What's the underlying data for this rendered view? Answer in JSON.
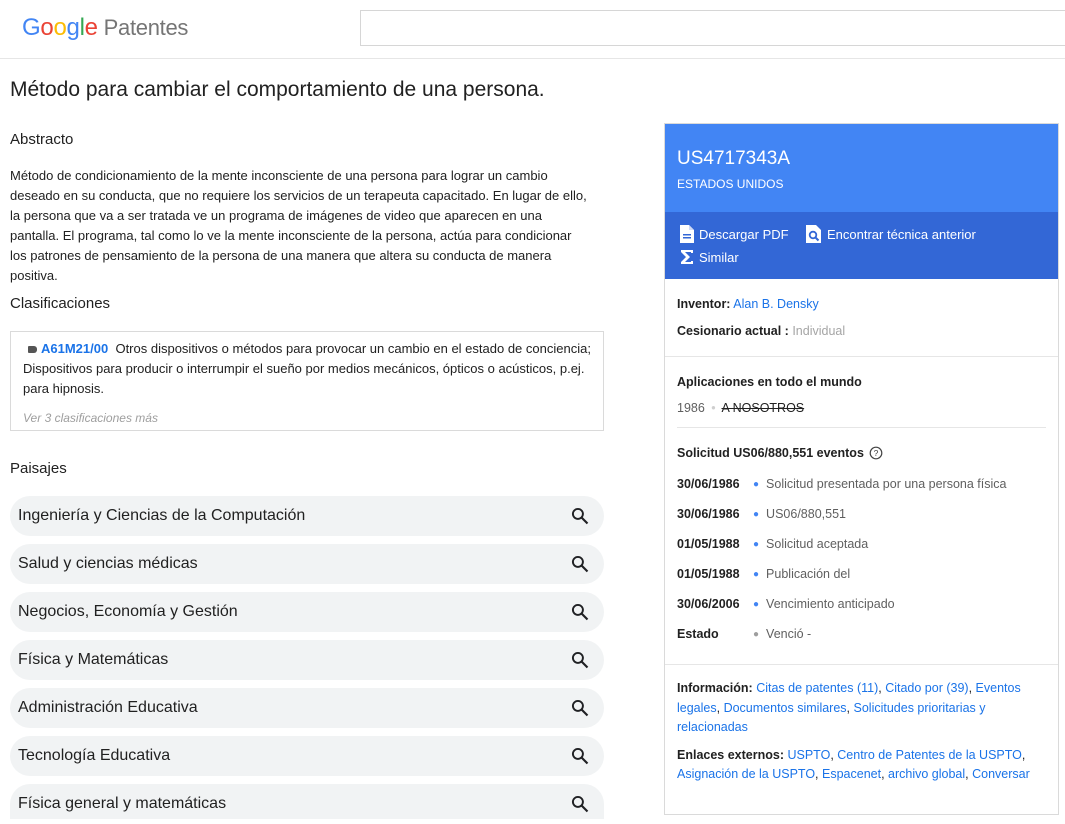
{
  "header": {
    "logo_letters": [
      "G",
      "o",
      "o",
      "g",
      "l",
      "e"
    ],
    "product": "Patentes",
    "search_value": ""
  },
  "title": "Método para cambiar el comportamiento de una persona.",
  "abstract": {
    "heading": "Abstracto",
    "text": "Método de condicionamiento de la mente inconsciente de una persona para lograr un cambio deseado en su conducta, que no requiere los servicios de un terapeuta capacitado. En lugar de ello, la persona que va a ser tratada ve un programa de imágenes de video que aparecen en una pantalla. El programa, tal como lo ve la mente inconsciente de la persona, actúa para condicionar los patrones de pensamiento de la persona de una manera que altera su conducta de manera positiva."
  },
  "classifications": {
    "heading": "Clasificaciones",
    "code": "A61M21/00",
    "description": "Otros dispositivos o métodos para provocar un cambio en el estado de conciencia; Dispositivos para producir o interrumpir el sueño por medios mecánicos, ópticos o acústicos, p.ej. para hipnosis.",
    "more": "Ver 3 clasificaciones más"
  },
  "landscapes": {
    "heading": "Paisajes",
    "items": [
      "Ingeniería y Ciencias de la Computación",
      "Salud y ciencias médicas",
      "Negocios, Economía y Gestión",
      "Física y Matemáticas",
      "Administración Educativa",
      "Tecnología Educativa",
      "Física general y matemáticas"
    ]
  },
  "panel": {
    "number": "US4717343A",
    "country": "ESTADOS UNIDOS",
    "actions": {
      "download": "Descargar PDF",
      "prior_art": "Encontrar técnica anterior",
      "similar": "Similar"
    },
    "inventor_label": "Inventor:",
    "inventor": "Alan B. Densky",
    "assignee_label": "Cesionario actual :",
    "assignee": "Individual",
    "worldwide_heading": "Aplicaciones en todo el mundo",
    "worldwide_year": "1986",
    "worldwide_country": "A NOSOTROS",
    "events_heading": "Solicitud US06/880,551 eventos",
    "events": [
      {
        "date": "30/06/1986",
        "text": "Solicitud presentada por una persona física"
      },
      {
        "date": "30/06/1986",
        "text": "US06/880,551"
      },
      {
        "date": "01/05/1988",
        "text": "Solicitud aceptada"
      },
      {
        "date": "01/05/1988",
        "text": "Publicación del"
      },
      {
        "date": "30/06/2006",
        "text": "Vencimiento anticipado"
      },
      {
        "date": "Estado",
        "text": "Venció -"
      }
    ],
    "info_label": "Información:",
    "info_links": [
      "Citas de patentes (11)",
      "Citado por (39)",
      "Eventos legales",
      "Documentos similares",
      "Solicitudes prioritarias y relacionadas"
    ],
    "external_label": "Enlaces externos:",
    "external_links": [
      "USPTO",
      "Centro de Patentes de la USPTO",
      "Asignación de la USPTO",
      "Espacenet",
      "archivo global",
      "Conversar"
    ]
  },
  "colors": {
    "brand_blue": "#4285f4",
    "actions_blue": "#3367d6",
    "link": "#1a73e8"
  }
}
